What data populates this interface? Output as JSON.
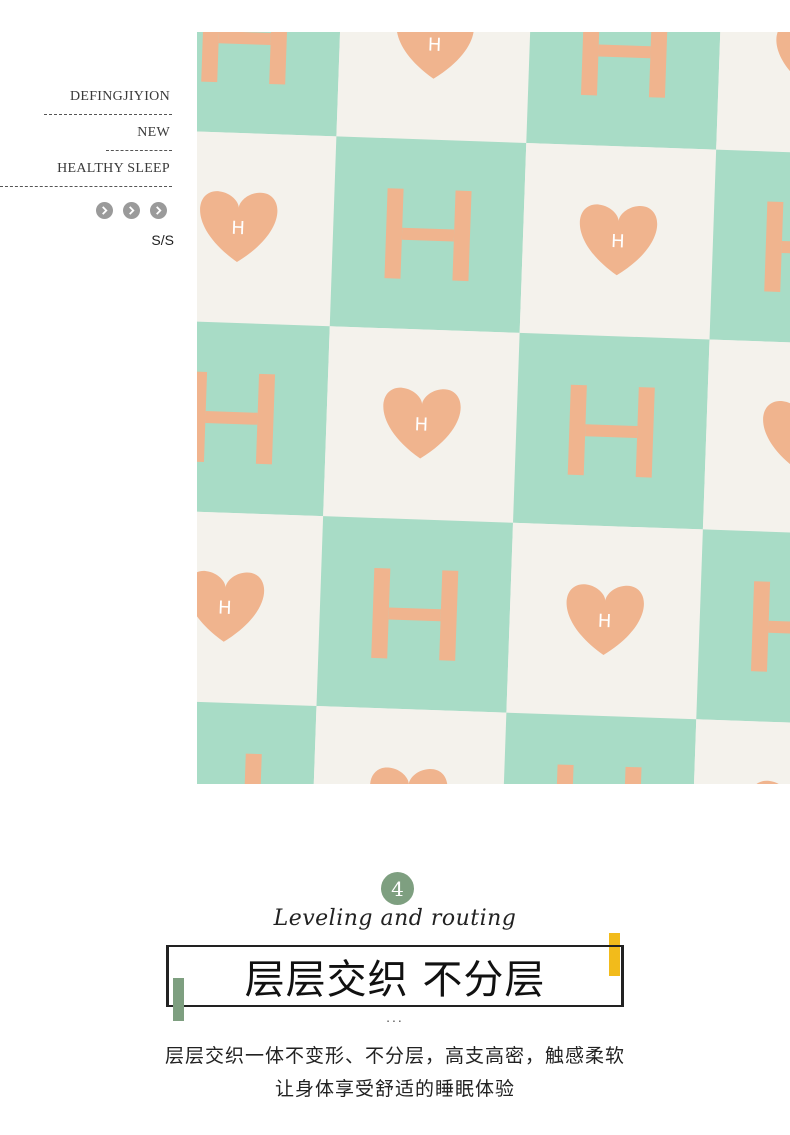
{
  "side_nav": {
    "brand": "DEFINGJIYION",
    "new": "NEW",
    "healthy": "HEALTHY SLEEP",
    "arrows_icon": "chevron-right-icon",
    "size": "S/S"
  },
  "photo": {
    "colors": {
      "mint": "#a8dcc6",
      "cream": "#f4f2ec",
      "peach": "#f0b48e"
    },
    "pattern_letter": "H"
  },
  "feature": {
    "number": "4",
    "script_title": "Leveling and routing",
    "title": "层层交织 不分层",
    "dots": "...",
    "desc_line1": "层层交织一体不变形、不分层，高支高密，触感柔软",
    "desc_line2": "让身体享受舒适的睡眠体验",
    "colors": {
      "accent_green": "#7e9f80",
      "accent_yellow": "#f2bb1b"
    }
  }
}
